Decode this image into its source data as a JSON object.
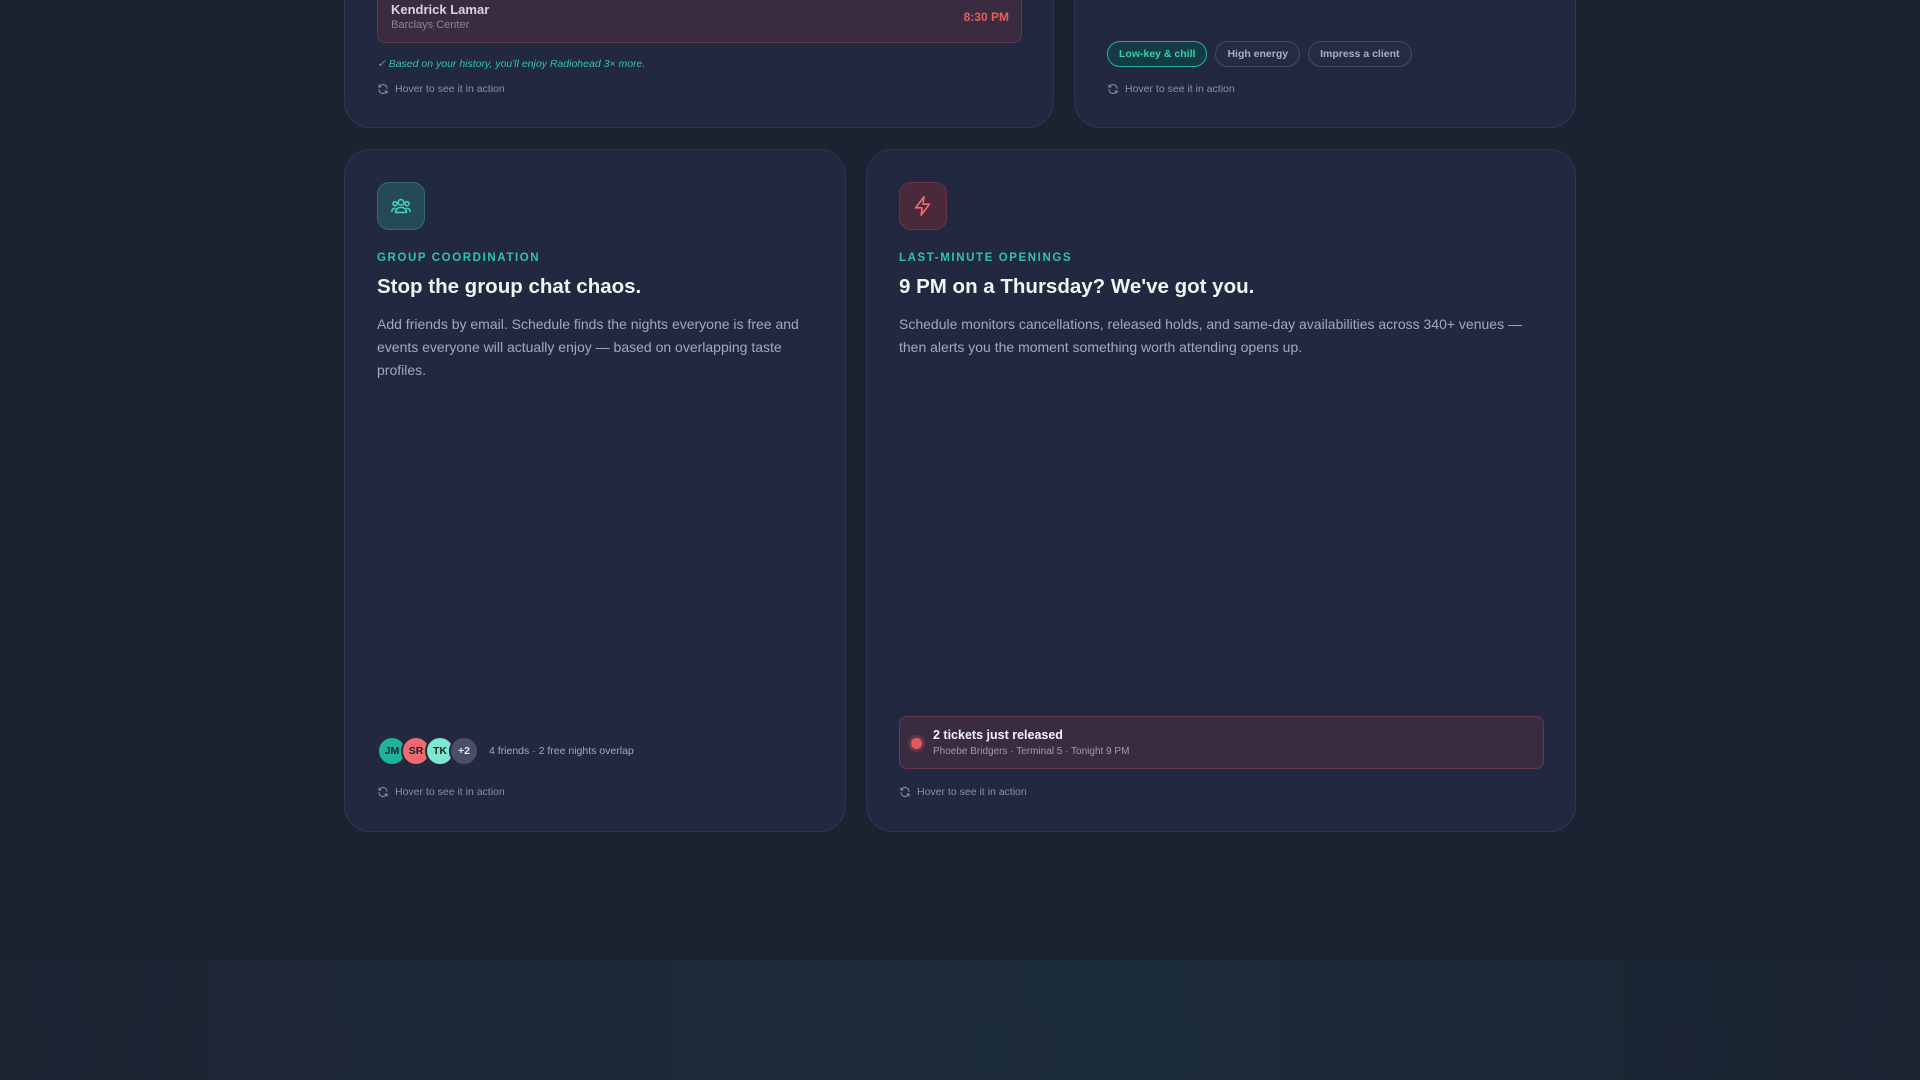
{
  "hint_text": "Hover to see it in action",
  "card_a": {
    "event_name": "Kendrick Lamar",
    "event_venue": "Barclays Center",
    "event_time": "8:30 PM",
    "note": "✓ Based on your history, you'll enjoy Radiohead 3× more."
  },
  "card_b": {
    "chips": [
      "Low-key & chill",
      "High energy",
      "Impress a client"
    ],
    "active_chip": "Low-key & chill"
  },
  "card_c": {
    "icon": "group-icon",
    "kicker": "GROUP COORDINATION",
    "headline": "Stop the group chat chaos.",
    "body_lines": [
      "Add friends by email. Schedule finds the nights everyone is free and",
      "events everyone will actually enjoy — based on overlapping taste",
      "profiles."
    ],
    "avatars": [
      {
        "initials": "JM",
        "color": "#1fb39a"
      },
      {
        "initials": "SR",
        "color": "#f06a6e"
      },
      {
        "initials": "TK",
        "color": "#7de8cf"
      },
      {
        "initials": "+2",
        "color": "#4a4f66"
      }
    ],
    "overlap_text": "4 friends · 2 free nights overlap"
  },
  "card_d": {
    "icon": "lightning-icon",
    "kicker": "LAST-MINUTE OPENINGS",
    "headline": "9 PM on a Thursday? We've got you.",
    "body_lines": [
      "Schedule monitors cancellations, released holds, and same-day availabilities across 340+ venues —",
      "then alerts you the moment something worth attending opens up."
    ],
    "alert_title": "2 tickets just released",
    "alert_sub": "Phoebe Bridgers · Terminal 5 · Tonight 9 PM"
  },
  "colors": {
    "accent_teal": "#2fc3a8",
    "accent_red": "#e05a5e",
    "card_bg": "#232841",
    "page_bg": "#1b2230"
  }
}
